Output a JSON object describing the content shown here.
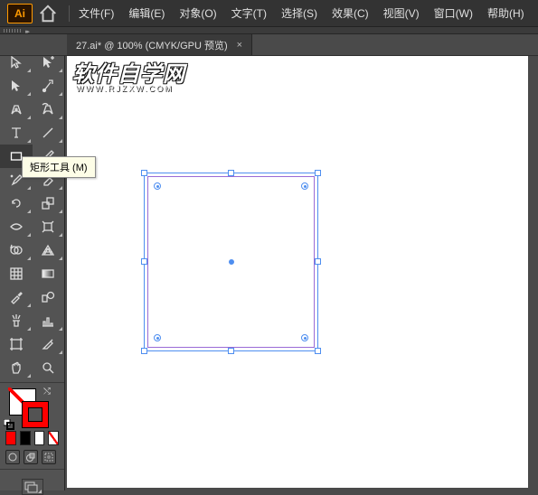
{
  "menubar": {
    "logo_text": "Ai",
    "items": [
      "文件(F)",
      "编辑(E)",
      "对象(O)",
      "文字(T)",
      "选择(S)",
      "效果(C)",
      "视图(V)",
      "窗口(W)",
      "帮助(H)"
    ]
  },
  "document_tab": {
    "label": "27.ai* @ 100% (CMYK/GPU 预览)",
    "close": "×"
  },
  "tooltip": {
    "text": "矩形工具 (M)"
  },
  "watermark": {
    "line1": "软件自学网",
    "line2": "WWW.RJZXW.COM"
  },
  "tools_left": [
    "selection-tool",
    "direct-selection-tool",
    "magic-wand-tool",
    "lasso-tool",
    "pen-tool",
    "curvature-tool",
    "type-tool",
    "line-segment-tool",
    "rectangle-tool",
    "paintbrush-tool",
    "shaper-tool",
    "eraser-tool",
    "rotate-tool",
    "scale-tool",
    "width-tool",
    "free-transform-tool",
    "shape-builder-tool",
    "perspective-grid-tool",
    "mesh-tool",
    "gradient-tool",
    "eyedropper-tool",
    "blend-tool",
    "symbol-sprayer-tool",
    "column-graph-tool",
    "artboard-tool",
    "slice-tool",
    "hand-tool",
    "zoom-tool"
  ],
  "selected_tool": "rectangle-tool",
  "swatches": {
    "row": [
      "#ff0000",
      "#000000",
      "#ffffff",
      "none"
    ]
  }
}
